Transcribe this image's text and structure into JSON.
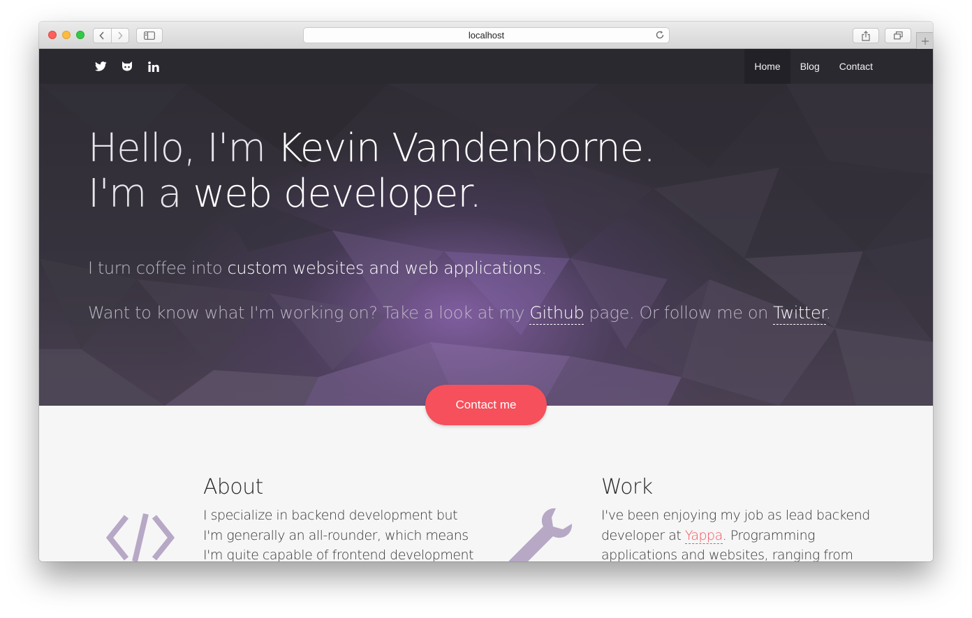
{
  "browser": {
    "url": "localhost"
  },
  "social": [
    "twitter-icon",
    "github-icon",
    "linkedin-icon"
  ],
  "nav": {
    "items": [
      {
        "label": "Home",
        "active": true
      },
      {
        "label": "Blog",
        "active": false
      },
      {
        "label": "Contact",
        "active": false
      }
    ]
  },
  "hero": {
    "line1_a": "Hello, I'm ",
    "line1_b": "Kevin Vandenborne",
    "line1_c": ".",
    "line2_a": "I'm a ",
    "line2_b": "web developer",
    "line2_c": ".",
    "tag_a": "I turn coffee into ",
    "tag_b": "custom websites and web applications",
    "tag_c": ".",
    "follow_a": "Want to know what I'm working on? Take a look at my ",
    "follow_github": "Github",
    "follow_b": " page. Or follow me on ",
    "follow_twitter": "Twitter",
    "follow_c": ".",
    "cta": "Contact me"
  },
  "about": {
    "title": "About",
    "lines": [
      "I specialize in backend development but",
      "I'm generally an all-rounder, which means",
      "I'm quite capable of frontend development"
    ],
    "icon": "code-icon"
  },
  "work": {
    "title": "Work",
    "line1": "I've been enjoying my job as lead backend",
    "line2_a": "developer at ",
    "line2_link": "Yappa",
    "line2_b": ". Programming",
    "line3": "applications and websites, ranging from",
    "icon": "wrench-icon"
  },
  "colors": {
    "accent": "#f5505b",
    "hero_dark": "#2e2b33",
    "hero_purple": "#8c64af",
    "icon_lilac": "#b7a8c6"
  }
}
